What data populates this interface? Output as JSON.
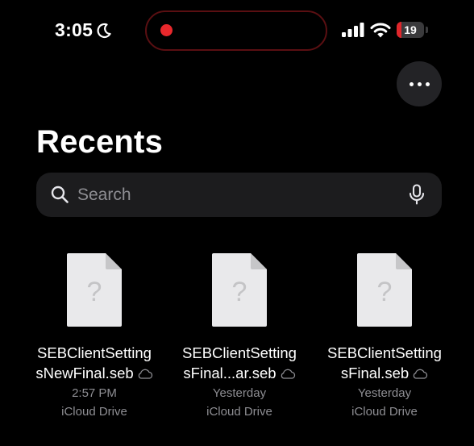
{
  "status_bar": {
    "time": "3:05",
    "battery_level": "19",
    "battery_fraction": 0.19,
    "icons": [
      "moon-icon",
      "cellular-signal-icon",
      "wifi-icon",
      "battery-icon"
    ],
    "recording_color": "#e8282c"
  },
  "header": {
    "more_icon": "ellipsis-icon",
    "title": "Recents"
  },
  "search": {
    "placeholder": "Search",
    "value": "",
    "icons": [
      "magnifying-glass-icon",
      "microphone-icon"
    ]
  },
  "files": [
    {
      "name_line1": "SEBClientSetting",
      "name_line2": "sNewFinal.seb",
      "date": "2:57 PM",
      "location": "iCloud Drive",
      "icon": "unknown-document-icon"
    },
    {
      "name_line1": "SEBClientSetting",
      "name_line2": "sFinal...ar.seb",
      "date": "Yesterday",
      "location": "iCloud Drive",
      "icon": "unknown-document-icon"
    },
    {
      "name_line1": "SEBClientSetting",
      "name_line2": "sFinal.seb",
      "date": "Yesterday",
      "location": "iCloud Drive",
      "icon": "unknown-document-icon"
    }
  ]
}
